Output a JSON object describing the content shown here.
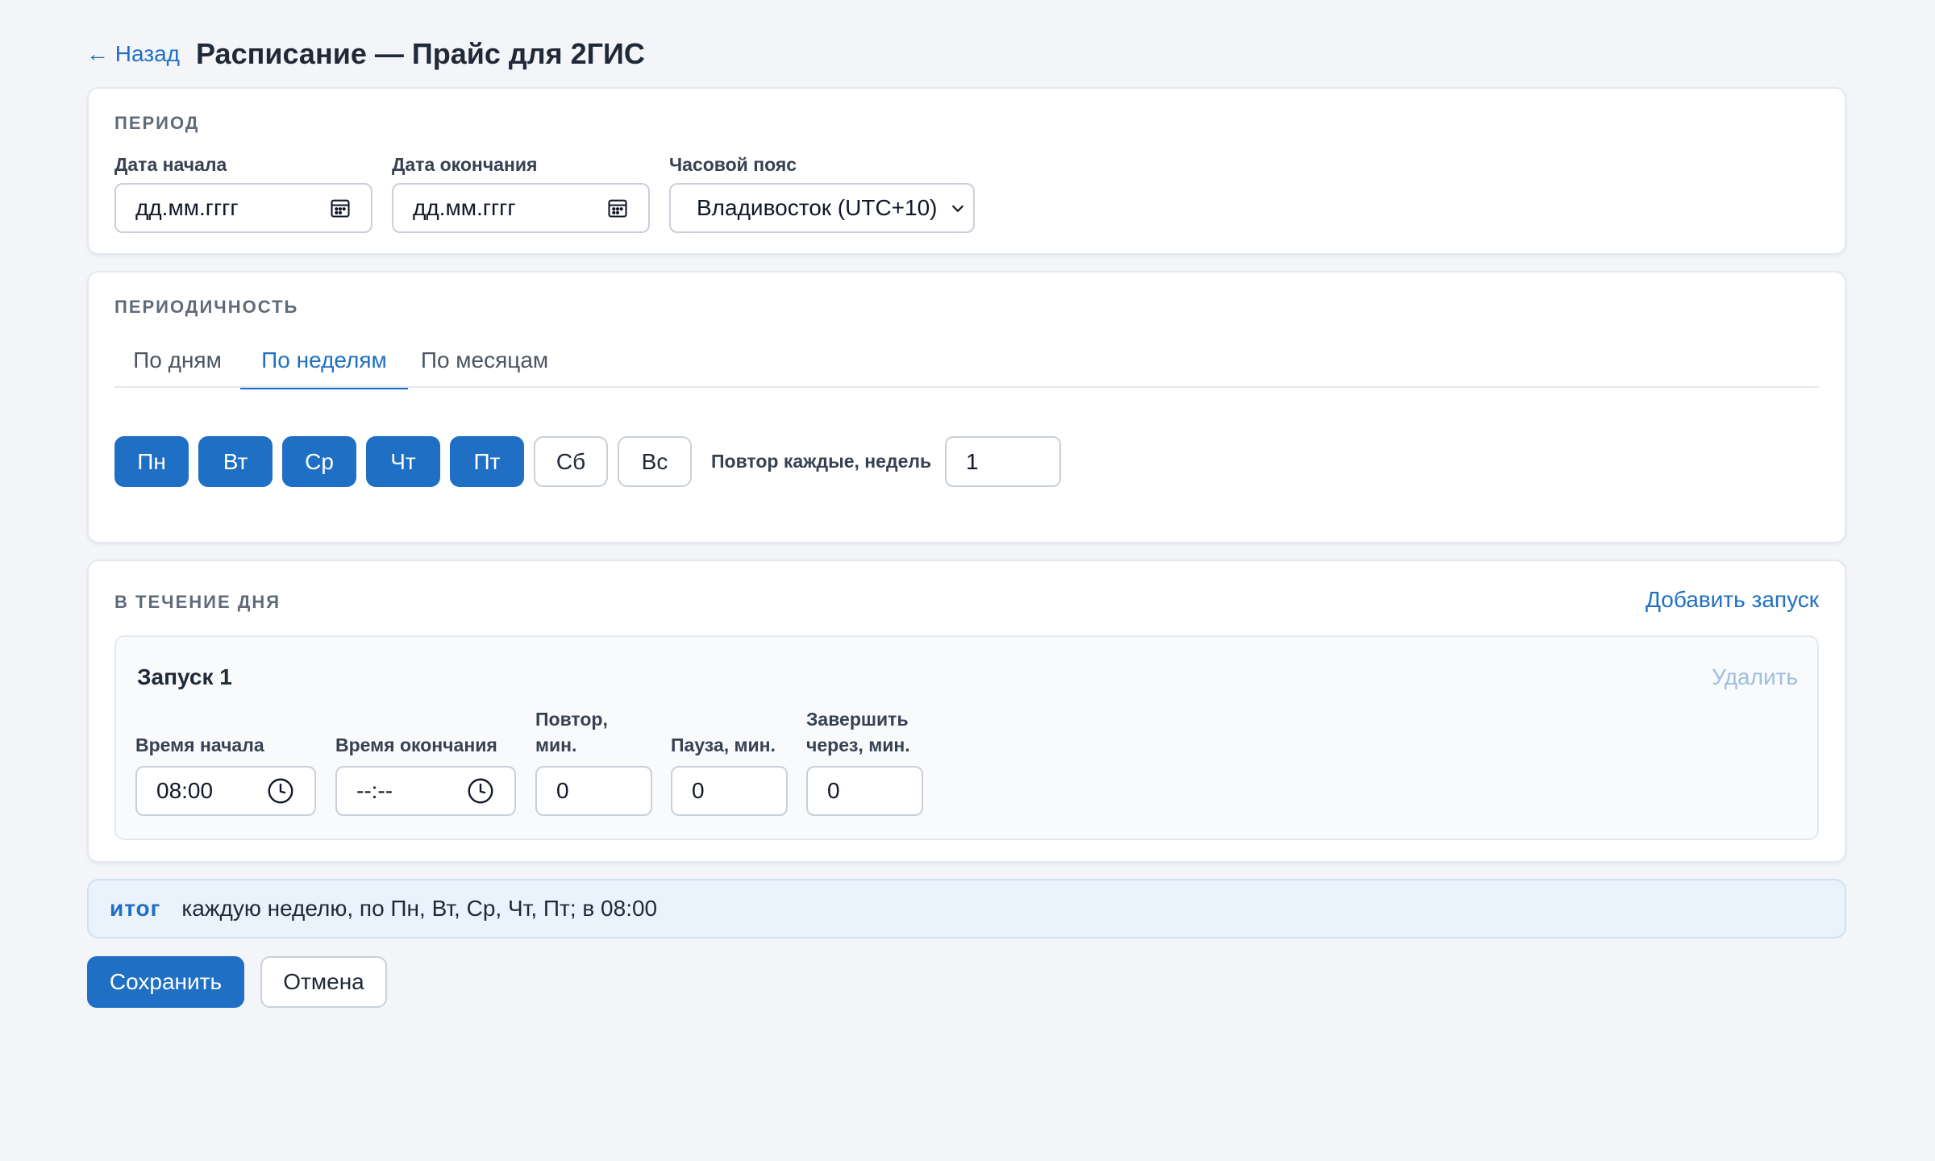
{
  "header": {
    "back_label": "← Назад",
    "title": "Расписание — Прайс для 2ГИС"
  },
  "period": {
    "section_title": "ПЕРИОД",
    "start_date_label": "Дата начала",
    "start_date_value": "дд.мм.гггг",
    "end_date_label": "Дата окончания",
    "end_date_value": "дд.мм.гггг",
    "timezone_label": "Часовой пояс",
    "timezone_value": "Владивосток (UTC+10)"
  },
  "periodicity": {
    "section_title": "ПЕРИОДИЧНОСТЬ",
    "tabs": [
      {
        "label": "По дням",
        "active": false
      },
      {
        "label": "По неделям",
        "active": true
      },
      {
        "label": "По месяцам",
        "active": false
      }
    ],
    "days": [
      {
        "label": "Пн",
        "selected": true
      },
      {
        "label": "Вт",
        "selected": true
      },
      {
        "label": "Ср",
        "selected": true
      },
      {
        "label": "Чт",
        "selected": true
      },
      {
        "label": "Пт",
        "selected": true
      },
      {
        "label": "Сб",
        "selected": false
      },
      {
        "label": "Вс",
        "selected": false
      }
    ],
    "repeat_label": "Повтор каждые, недель",
    "repeat_value": "1"
  },
  "during_day": {
    "section_title": "В ТЕЧЕНИЕ ДНЯ",
    "add_label": "Добавить запуск",
    "runs": [
      {
        "title": "Запуск 1",
        "delete_label": "Удалить",
        "start_time_label": "Время начала",
        "start_time_value": "08:00",
        "end_time_label": "Время окончания",
        "end_time_value": "--:--",
        "repeat_label_1": "Повтор,",
        "repeat_label_2": "мин.",
        "repeat_value": "0",
        "pause_label": "Пауза, мин.",
        "pause_value": "0",
        "finish_label_1": "Завершить",
        "finish_label_2": "через, мин.",
        "finish_value": "0"
      }
    ]
  },
  "summary": {
    "label": "итог",
    "text": "каждую неделю, по Пн, Вт, Ср, Чт, Пт; в 08:00"
  },
  "actions": {
    "save_label": "Сохранить",
    "cancel_label": "Отмена"
  },
  "colors": {
    "accent": "#1f6fc5",
    "background": "#f3f5f9",
    "summary_bg": "#eaf2fc",
    "muted_link": "#9fbde0"
  },
  "icons": {
    "date_fields": "calendar-icon",
    "time_fields": "clock-icon",
    "timezone": "chevron-down-icon"
  }
}
